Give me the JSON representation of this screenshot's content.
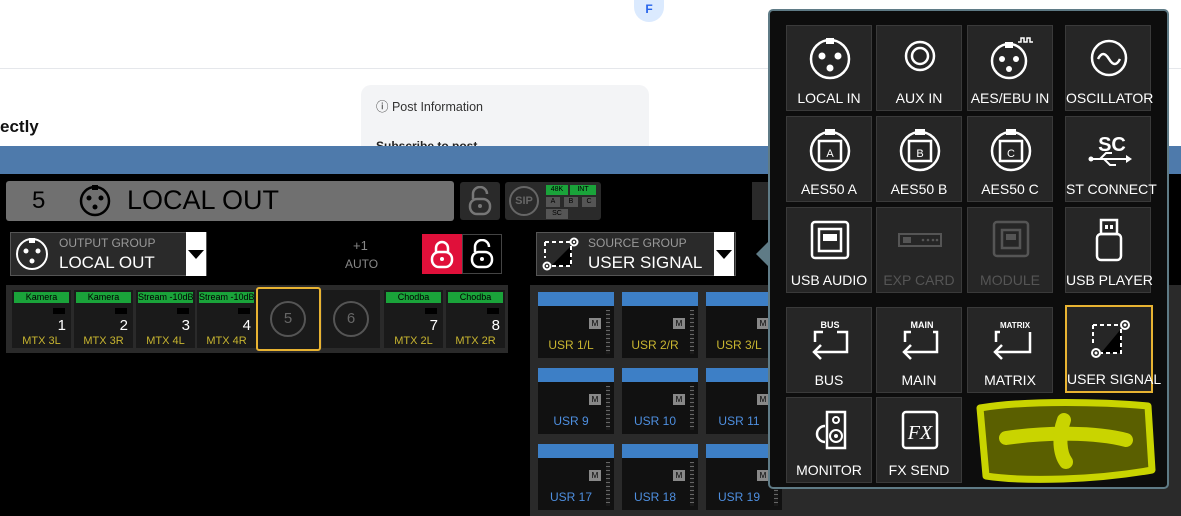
{
  "web": {
    "avatar": "F",
    "heading": "ectly",
    "card_title": "ⓘ Post Information",
    "card_sub": "Subscribe to post"
  },
  "channel": {
    "number": "5",
    "name": "LOCAL OUT",
    "sip": "SIP",
    "clock": [
      "48K",
      "INT",
      "A",
      "B",
      "C",
      "SC"
    ]
  },
  "output_group": {
    "label": "OUTPUT GROUP",
    "value": "LOCAL OUT",
    "plus": "+1",
    "auto": "AUTO"
  },
  "slots": [
    {
      "tag": "Kamera",
      "num": "1",
      "src": "MTX 3L"
    },
    {
      "tag": "Kamera",
      "num": "2",
      "src": "MTX 3R"
    },
    {
      "tag": "Stream -10dB",
      "num": "3",
      "src": "MTX 4L"
    },
    {
      "tag": "Stream -10dB",
      "num": "4",
      "src": "MTX 4R"
    },
    {
      "ring": "5"
    },
    {
      "ring": "6"
    },
    {
      "tag": "Chodba",
      "num": "7",
      "src": "MTX 2L"
    },
    {
      "tag": "Chodba",
      "num": "8",
      "src": "MTX 2R"
    }
  ],
  "source_group": {
    "label": "SOURCE GROUP",
    "value": "USER SIGNAL"
  },
  "usr_rows": [
    [
      "USR 1/L",
      "USR 2/R",
      "USR 3/L"
    ],
    [
      "USR 9",
      "USR 10",
      "USR 11"
    ],
    [
      "USR 17",
      "USR 18",
      "USR 19"
    ]
  ],
  "usr_mute_label": "M",
  "popup": {
    "tiles": [
      {
        "label": "LOCAL IN",
        "icon": "xlr-icon",
        "enabled": true
      },
      {
        "label": "AUX IN",
        "icon": "rca-icon",
        "enabled": true
      },
      {
        "label": "AES/EBU IN",
        "icon": "aes-ebu-icon",
        "enabled": true
      },
      {
        "label": "OSCILLATOR",
        "icon": "oscillator-icon",
        "enabled": true
      },
      {
        "label": "AES50 A",
        "icon": "aes50-a-icon",
        "badge": "A",
        "enabled": true
      },
      {
        "label": "AES50 B",
        "icon": "aes50-b-icon",
        "badge": "B",
        "enabled": true
      },
      {
        "label": "AES50 C",
        "icon": "aes50-c-icon",
        "badge": "C",
        "enabled": true
      },
      {
        "label": "ST CONNECT",
        "icon": "st-connect-icon",
        "badge": "SC",
        "enabled": true
      },
      {
        "label": "USB AUDIO",
        "icon": "usb-audio-icon",
        "enabled": true
      },
      {
        "label": "EXP CARD",
        "icon": "exp-card-icon",
        "enabled": false
      },
      {
        "label": "MODULE",
        "icon": "module-icon",
        "enabled": false
      },
      {
        "label": "USB PLAYER",
        "icon": "usb-player-icon",
        "enabled": true
      },
      {
        "label": "BUS",
        "icon": "bus-icon",
        "badge": "BUS",
        "enabled": true
      },
      {
        "label": "MAIN",
        "icon": "main-icon",
        "badge": "MAIN",
        "enabled": true
      },
      {
        "label": "MATRIX",
        "icon": "matrix-icon",
        "badge": "MATRIX",
        "enabled": true
      },
      {
        "label": "USER SIGNAL",
        "icon": "user-signal-icon",
        "enabled": true,
        "selected": true
      },
      {
        "label": "MONITOR",
        "icon": "monitor-icon",
        "enabled": true
      },
      {
        "label": "FX SEND",
        "icon": "fx-send-icon",
        "badge": "FX",
        "enabled": true
      }
    ]
  },
  "colors": {
    "accent_selected": "#e8b332",
    "lock_red": "#e0103a",
    "tag_green": "#1aa33a",
    "usr_blue": "#3d7fc6",
    "annotation": "#c9d400"
  }
}
